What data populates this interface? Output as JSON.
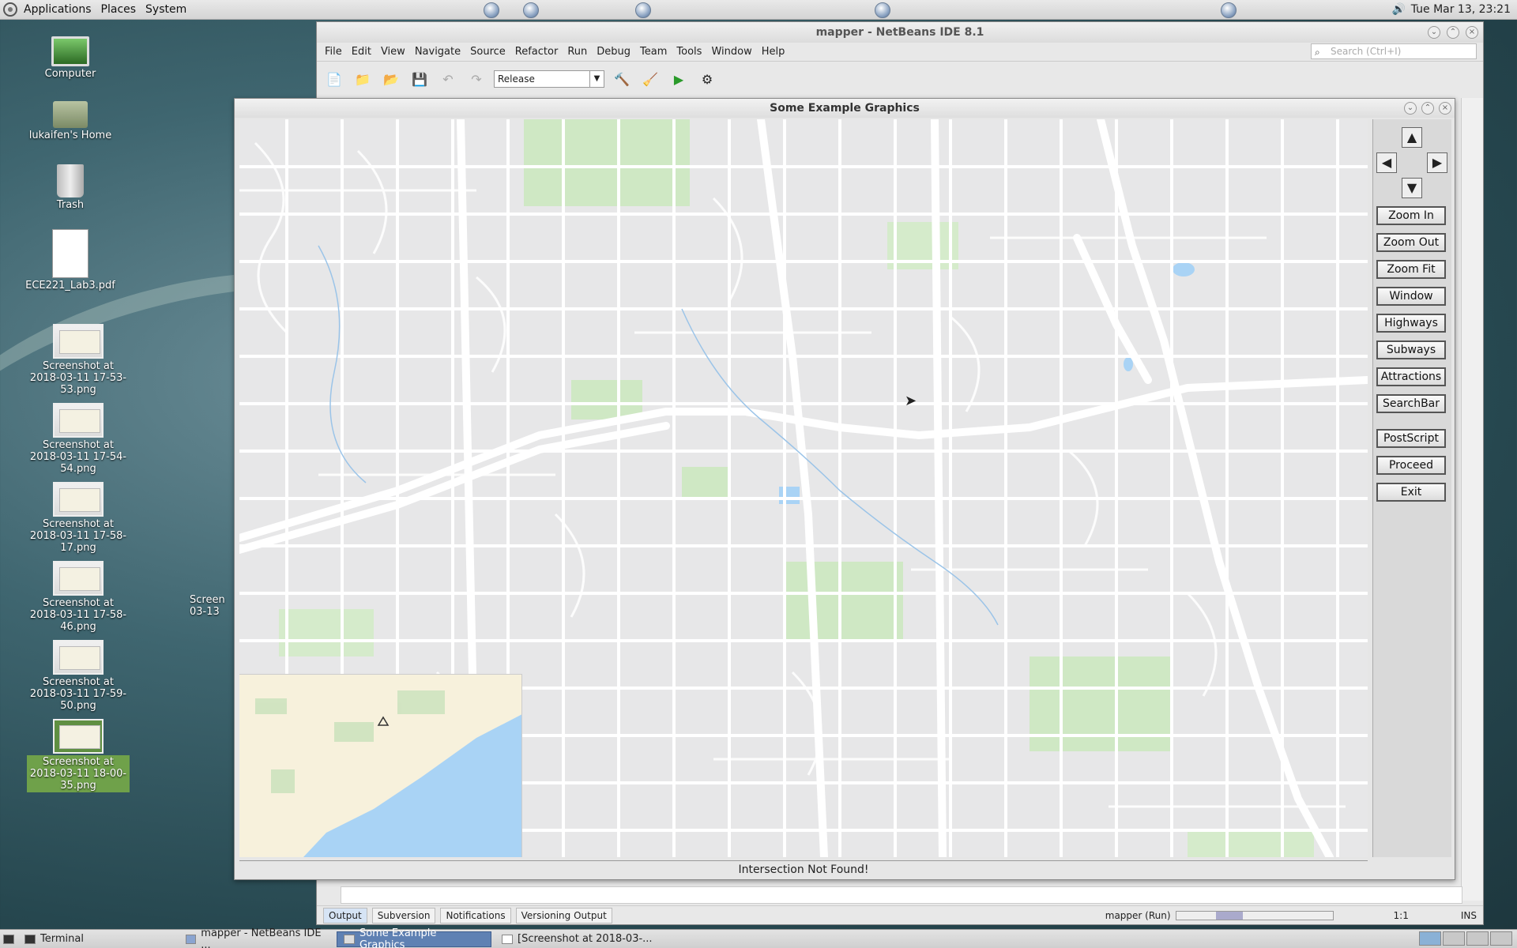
{
  "top_panel": {
    "menus": [
      "Applications",
      "Places",
      "System"
    ],
    "clock": "Tue Mar 13, 23:21"
  },
  "desktop": {
    "icons": [
      {
        "label": "Computer",
        "kind": "monitor"
      },
      {
        "label": "lukaifen's Home",
        "kind": "folder"
      },
      {
        "label": "Trash",
        "kind": "trash"
      },
      {
        "label": "ECE221_Lab3.pdf",
        "kind": "pdf"
      },
      {
        "label": "Screenshot at 2018-03-11 17-53-53.png",
        "kind": "thumb"
      },
      {
        "label": "Screenshot at 2018-03-11 17-54-54.png",
        "kind": "thumb"
      },
      {
        "label": "Screenshot at 2018-03-11 17-58-17.png",
        "kind": "thumb"
      },
      {
        "label": "Screenshot at 2018-03-11 17-58-46.png",
        "kind": "thumb"
      },
      {
        "label": "Screenshot at 2018-03-11 17-59-50.png",
        "kind": "thumb"
      },
      {
        "label": "Screenshot at 2018-03-11 18-00-35.png",
        "kind": "thumb",
        "selected": true
      }
    ],
    "partial_icon_label": "Screen 03-13"
  },
  "netbeans": {
    "title": "mapper - NetBeans IDE 8.1",
    "menu": [
      "File",
      "Edit",
      "View",
      "Navigate",
      "Source",
      "Refactor",
      "Run",
      "Debug",
      "Team",
      "Tools",
      "Window",
      "Help"
    ],
    "search_placeholder": "Search (Ctrl+I)",
    "config": "Release",
    "output_tabs": [
      "Output",
      "Subversion",
      "Notifications",
      "Versioning Output"
    ],
    "run_status": "mapper (Run)",
    "position": "1:1",
    "insert_mode": "INS"
  },
  "graphics_window": {
    "title": "Some Example Graphics",
    "buttons": [
      "Zoom In",
      "Zoom Out",
      "Zoom Fit",
      "Window",
      "Highways",
      "Subways",
      "Attractions",
      "SearchBar",
      "PostScript",
      "Proceed",
      "Exit"
    ],
    "status": "Intersection Not Found!"
  },
  "taskbar": {
    "tasks": [
      {
        "label": "Terminal"
      },
      {
        "label": "mapper - NetBeans IDE ..."
      },
      {
        "label": "Some Example Graphics",
        "active": true
      },
      {
        "label": "[Screenshot at 2018-03-..."
      }
    ]
  },
  "colors": {
    "map_bg": "#e7e7e8",
    "park": "#cfe8c4",
    "water": "#a9d3f5",
    "road": "#ffffff",
    "active_task": "#5f81b3"
  }
}
